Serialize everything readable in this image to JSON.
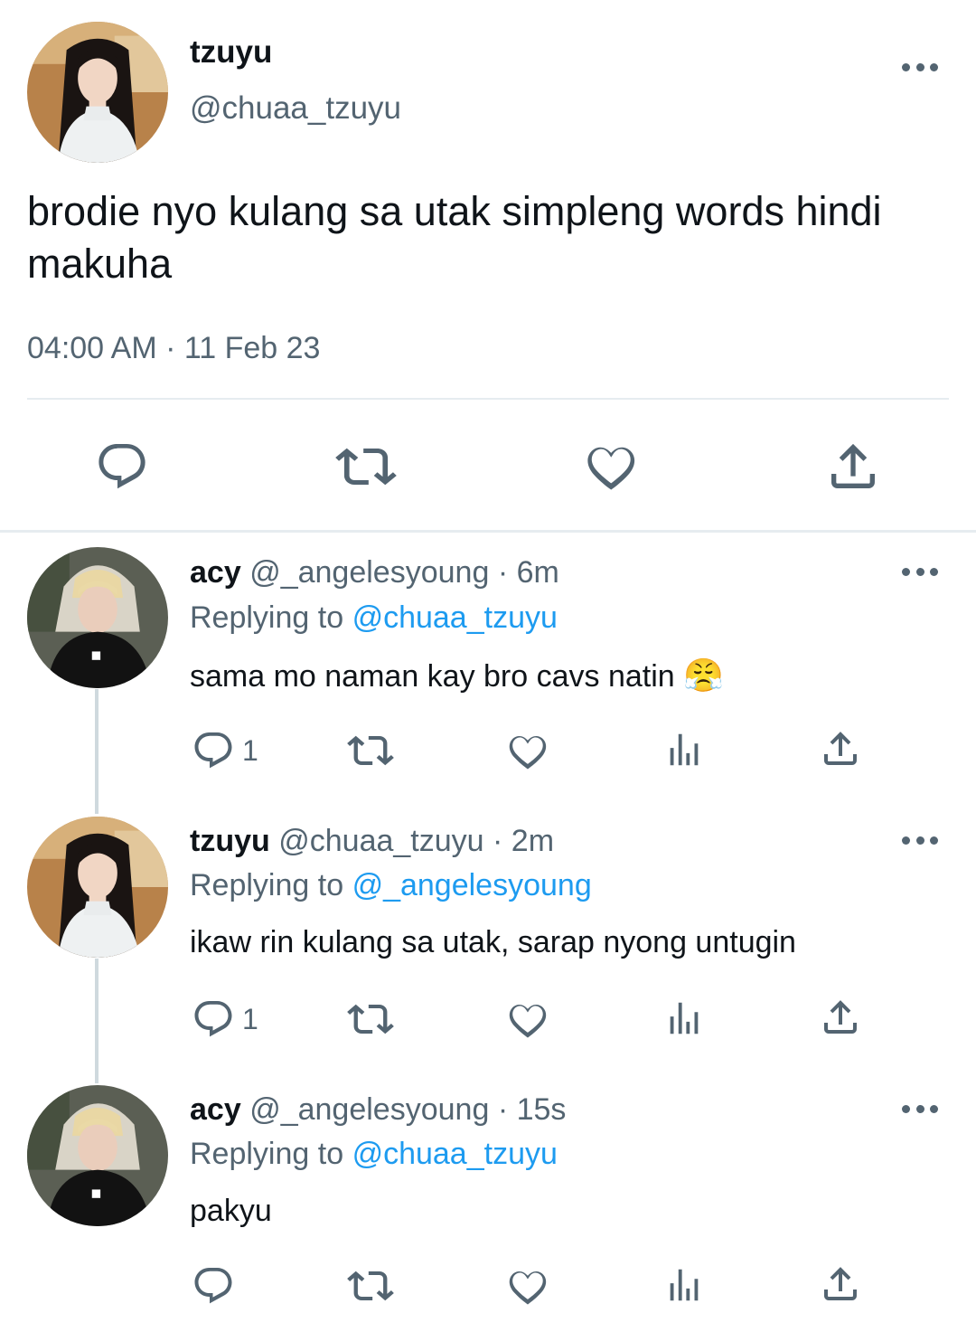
{
  "main_tweet": {
    "display_name": "tzuyu",
    "handle": "@chuaa_tzuyu",
    "text_line1": "brodie nyo kulang sa utak simpleng words hindi",
    "text_line2": "makuha",
    "timestamp": "04:00 AM · 11 Feb 23"
  },
  "replies": [
    {
      "display_name": "acy",
      "handle": "@_angelesyoung",
      "time": "· 6m",
      "replying_label": "Replying to",
      "replying_to": "@chuaa_tzuyu",
      "text": "sama mo naman kay bro cavs natin",
      "emoji": "😤",
      "reply_count": "1"
    },
    {
      "display_name": "tzuyu",
      "handle": "@chuaa_tzuyu",
      "time": "· 2m",
      "replying_label": "Replying to",
      "replying_to": "@_angelesyoung",
      "text": "ikaw rin kulang sa utak, sarap nyong untugin",
      "reply_count": "1"
    },
    {
      "display_name": "acy",
      "handle": "@_angelesyoung",
      "time": "· 15s",
      "replying_label": "Replying to",
      "replying_to": "@chuaa_tzuyu",
      "text": "pakyu",
      "reply_count": ""
    }
  ],
  "icons": [
    "reply-icon",
    "retweet-icon",
    "like-icon",
    "views-icon",
    "share-icon",
    "more-icon"
  ],
  "colors": {
    "text": "#0f1419",
    "muted": "#536471",
    "link": "#1d9bf0",
    "divider": "#e6ecf0"
  }
}
